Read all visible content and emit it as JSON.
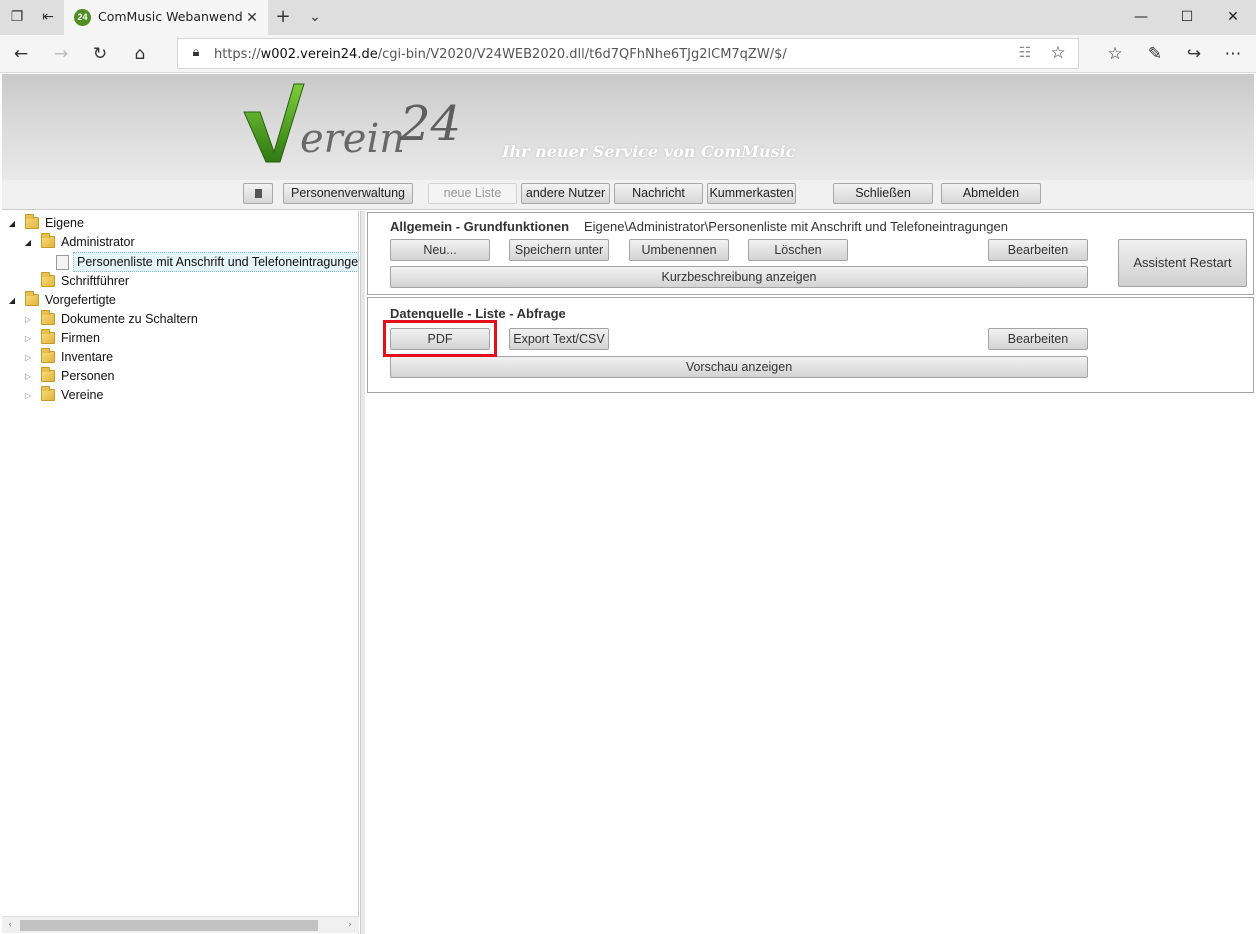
{
  "browser": {
    "tab_title": "ComMusic Webanwend",
    "favicon_text": "24",
    "url_prefix": "https://",
    "url_domain": "w002.verein24.de",
    "url_path": "/cgi-bin/V2020/V24WEB2020.dll/t6d7QFhNhe6TJg2lCM7qZW/$/"
  },
  "header": {
    "logo_text": "Verein 24",
    "tagline": "Ihr neuer Service von ComMusic"
  },
  "menubar": {
    "items": [
      {
        "label": "Personenverwaltung"
      },
      {
        "label": "neue Liste"
      },
      {
        "label": "andere Nutzer"
      },
      {
        "label": "Nachricht"
      },
      {
        "label": "Kummerkasten"
      },
      {
        "label": "Schließen"
      },
      {
        "label": "Abmelden"
      }
    ]
  },
  "tree": {
    "nodes": [
      {
        "label": "Eigene"
      },
      {
        "label": "Administrator"
      },
      {
        "label": "Personenliste mit Anschrift und Telefoneintragungen"
      },
      {
        "label": "Schriftführer"
      },
      {
        "label": "Vorgefertigte"
      },
      {
        "label": "Dokumente zu Schaltern"
      },
      {
        "label": "Firmen"
      },
      {
        "label": "Inventare"
      },
      {
        "label": "Personen"
      },
      {
        "label": "Vereine"
      }
    ]
  },
  "panel_general": {
    "title": "Allgemein - Grundfunktionen",
    "path": "Eigene\\Administrator\\Personenliste mit Anschrift und Telefoneintragungen",
    "new_label": "Neu...",
    "save_as_label": "Speichern unter",
    "rename_label": "Umbenennen",
    "delete_label": "Löschen",
    "edit_label": "Bearbeiten",
    "description_label": "Kurzbeschreibung anzeigen",
    "assistant_label": "Assistent Restart"
  },
  "panel_source": {
    "title": "Datenquelle - Liste - Abfrage",
    "pdf_label": "PDF",
    "export_label": "Export Text/CSV",
    "edit_label": "Bearbeiten",
    "preview_label": "Vorschau anzeigen"
  }
}
